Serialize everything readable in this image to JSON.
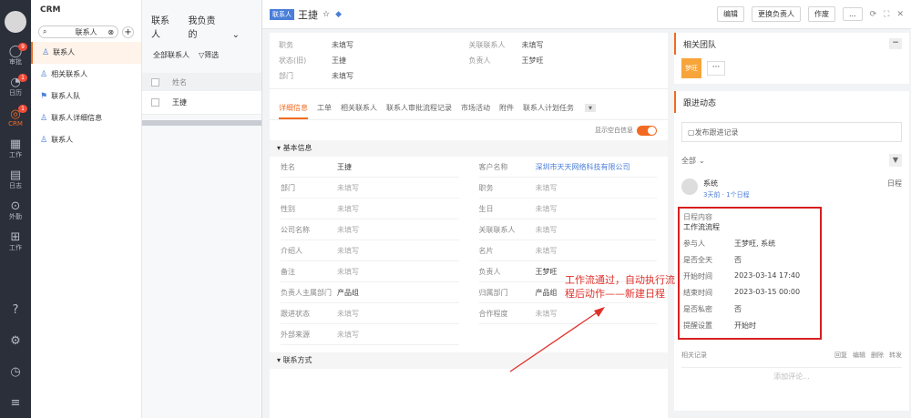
{
  "rail": {
    "items": [
      {
        "label": "审批",
        "icon": "chat-icon",
        "badge": "9"
      },
      {
        "label": "日历",
        "icon": "calendar-icon",
        "badge": "1"
      },
      {
        "label": "CRM",
        "icon": "crm-icon",
        "badge": "1",
        "active": true
      },
      {
        "label": "工作",
        "icon": "work-icon"
      },
      {
        "label": "日志",
        "icon": "log-icon"
      },
      {
        "label": "外勤",
        "icon": "location-icon"
      },
      {
        "label": "工作",
        "icon": "apps-icon"
      }
    ]
  },
  "sub": {
    "title": "CRM",
    "search_placeholder": "联系人",
    "items": [
      "联系人",
      "相关联系人",
      "联系人队",
      "联系人详细信息",
      "联系人"
    ]
  },
  "list": {
    "tabs": [
      "联系人",
      "我负责的"
    ],
    "filter": "全部联系人",
    "filter2": "▽筛选",
    "col": "姓名",
    "row_name": "王捷"
  },
  "header": {
    "tag": "联系人",
    "name": "王捷",
    "buttons": [
      "编辑",
      "更换负责人",
      "作废",
      "..."
    ]
  },
  "summary": [
    {
      "k": "职务",
      "v": "未填写"
    },
    {
      "k": "关联联系人",
      "v": "未填写"
    },
    {
      "k": "状态(旧)",
      "v": "王捷"
    },
    {
      "k": "负责人",
      "v": "王梦旺"
    },
    {
      "k": "部门",
      "v": "未填写"
    },
    {
      "k": "",
      "v": ""
    }
  ],
  "tabs": [
    "详细信息",
    "工单",
    "相关联系人",
    "联系人审批流程记录",
    "市场活动",
    "附件",
    "联系人计划任务"
  ],
  "toggle_label": "显示空白信息",
  "section_basic": "基本信息",
  "fields": [
    {
      "k": "姓名",
      "v": "王捷",
      "s": "dark"
    },
    {
      "k": "客户名称",
      "v": "深圳市天天网络科技有限公司",
      "s": "link"
    },
    {
      "k": "部门",
      "v": "未填写"
    },
    {
      "k": "职务",
      "v": "未填写"
    },
    {
      "k": "性别",
      "v": "未填写"
    },
    {
      "k": "生日",
      "v": "未填写"
    },
    {
      "k": "公司名称",
      "v": "未填写"
    },
    {
      "k": "关联联系人",
      "v": "未填写"
    },
    {
      "k": "介绍人",
      "v": "未填写"
    },
    {
      "k": "名片",
      "v": "未填写"
    },
    {
      "k": "备注",
      "v": "未填写"
    },
    {
      "k": "负责人",
      "v": "王梦旺",
      "s": "dark"
    },
    {
      "k": "负责人主属部门",
      "v": "产品组",
      "s": "dark"
    },
    {
      "k": "归属部门",
      "v": "产品组",
      "s": "dark"
    },
    {
      "k": "跟进状态",
      "v": "未填写"
    },
    {
      "k": "合作程度",
      "v": "未填写"
    },
    {
      "k": "外部来源",
      "v": "未填写"
    }
  ],
  "section_contact": "联系方式",
  "team": {
    "title": "相关团队",
    "member": "梦旺"
  },
  "follow": {
    "title": "跟进动态",
    "input_placeholder": "发布跟进记录",
    "filter": "全部",
    "poster": "系统",
    "meta": "3天前 · 1个日程",
    "right": "日程",
    "schedule_title": "日程内容",
    "schedule_sub": "工作流流程",
    "kv": [
      {
        "k": "参与人",
        "v": "王梦旺, 系统"
      },
      {
        "k": "是否全天",
        "v": "否"
      },
      {
        "k": "开始时间",
        "v": "2023-03-14 17:40"
      },
      {
        "k": "结束时间",
        "v": "2023-03-15 00:00"
      },
      {
        "k": "是否私密",
        "v": "否"
      },
      {
        "k": "提醒设置",
        "v": "开始时"
      }
    ],
    "actions_left": "相关记录",
    "actions_right": [
      "回复",
      "编辑",
      "删除",
      "转发"
    ],
    "comment_placeholder": "添加评论..."
  },
  "annotation": "工作流通过，自动执行流程后动作——新建日程",
  "colors": {
    "accent": "#f26a21",
    "link": "#4a7ed8",
    "annotation": "#e0302a"
  }
}
